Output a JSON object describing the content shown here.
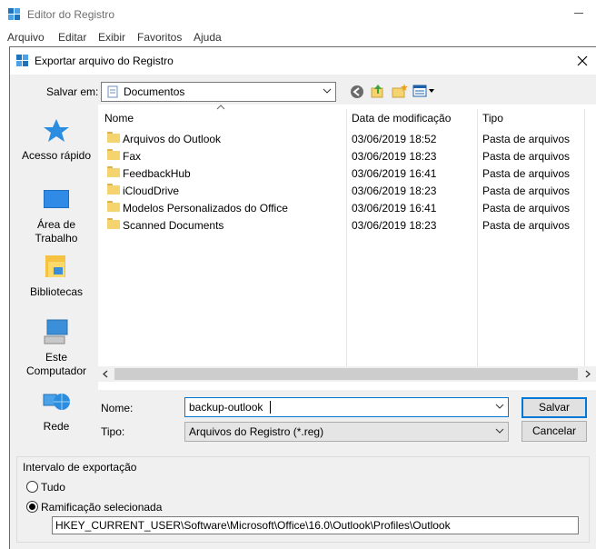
{
  "app": {
    "title": "Editor do Registro",
    "menu": [
      "Arquivo",
      "Editar",
      "Exibir",
      "Favoritos",
      "Ajuda"
    ]
  },
  "dialog": {
    "title": "Exportar arquivo do Registro",
    "save_in_label": "Salvar em:",
    "save_in_value": "Documentos",
    "places": [
      {
        "label": "Acesso rápido",
        "icon": "star-icon"
      },
      {
        "label": "Área de Trabalho",
        "icon": "desktop-icon"
      },
      {
        "label": "Bibliotecas",
        "icon": "libraries-icon"
      },
      {
        "label": "Este Computador",
        "icon": "computer-icon"
      },
      {
        "label": "Rede",
        "icon": "network-icon"
      }
    ],
    "columns": {
      "name": "Nome",
      "date": "Data de modificação",
      "type": "Tipo"
    },
    "files": [
      {
        "name": "Arquivos do Outlook",
        "date": "03/06/2019 18:52",
        "type": "Pasta de arquivos"
      },
      {
        "name": "Fax",
        "date": "03/06/2019 18:23",
        "type": "Pasta de arquivos"
      },
      {
        "name": "FeedbackHub",
        "date": "03/06/2019 16:41",
        "type": "Pasta de arquivos"
      },
      {
        "name": "iCloudDrive",
        "date": "03/06/2019 18:23",
        "type": "Pasta de arquivos"
      },
      {
        "name": "Modelos Personalizados do Office",
        "date": "03/06/2019 16:41",
        "type": "Pasta de arquivos"
      },
      {
        "name": "Scanned Documents",
        "date": "03/06/2019 18:23",
        "type": "Pasta de arquivos"
      }
    ],
    "name_label": "Nome:",
    "name_value": "backup-outlook",
    "type_label": "Tipo:",
    "type_value": "Arquivos do Registro (*.reg)",
    "save_button": "Salvar",
    "cancel_button": "Cancelar",
    "export_range": {
      "title": "Intervalo de exportação",
      "all_label": "Tudo",
      "branch_label": "Ramificação selecionada",
      "selected": "branch",
      "path": "HKEY_CURRENT_USER\\Software\\Microsoft\\Office\\16.0\\Outlook\\Profiles\\Outlook"
    }
  },
  "colors": {
    "accent": "#0078d7",
    "folder": "#f5d36e",
    "registry": "#1e73be"
  }
}
